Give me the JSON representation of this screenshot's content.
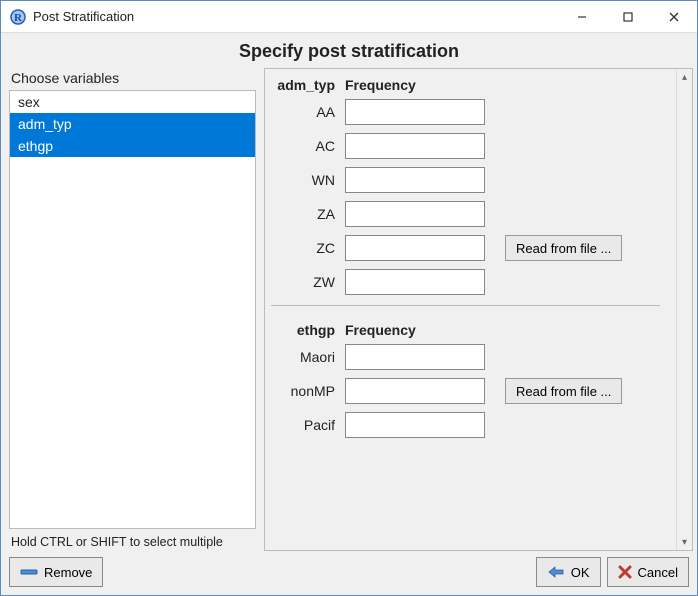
{
  "window": {
    "title": "Post Stratification"
  },
  "heading": "Specify post stratification",
  "left": {
    "label": "Choose variables",
    "hint": "Hold CTRL or SHIFT to select multiple",
    "items": [
      {
        "name": "sex",
        "selected": false
      },
      {
        "name": "adm_typ",
        "selected": true
      },
      {
        "name": "ethgp",
        "selected": true
      }
    ]
  },
  "right": {
    "freq_header": "Frequency",
    "read_label": "Read from file ...",
    "groups": [
      {
        "var": "adm_typ",
        "read_button_row": 4,
        "levels": [
          {
            "label": "AA",
            "value": ""
          },
          {
            "label": "AC",
            "value": ""
          },
          {
            "label": "WN",
            "value": ""
          },
          {
            "label": "ZA",
            "value": ""
          },
          {
            "label": "ZC",
            "value": ""
          },
          {
            "label": "ZW",
            "value": ""
          }
        ]
      },
      {
        "var": "ethgp",
        "read_button_row": 1,
        "levels": [
          {
            "label": "Maori",
            "value": ""
          },
          {
            "label": "nonMP",
            "value": ""
          },
          {
            "label": "Pacif",
            "value": ""
          }
        ]
      }
    ]
  },
  "buttons": {
    "remove": "Remove",
    "ok": "OK",
    "cancel": "Cancel"
  }
}
